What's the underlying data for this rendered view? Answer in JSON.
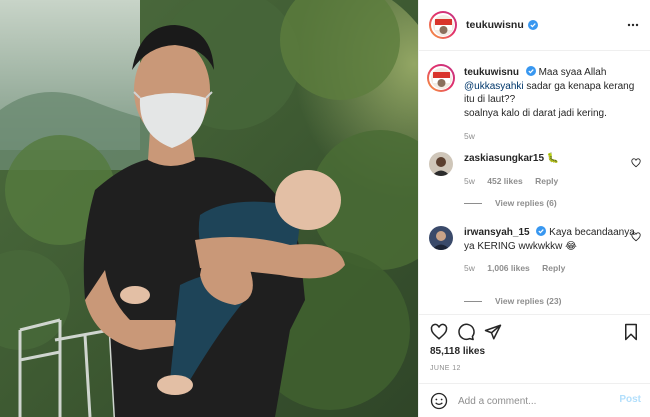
{
  "post": {
    "author": {
      "username": "teukuwisnu",
      "verified": true
    },
    "photo": {
      "subject": "man in face mask holding a sleeping baby outdoors",
      "caption_alt": ""
    },
    "caption": {
      "username": "teukuwisnu",
      "text_before_mention": "Maa syaa Allah",
      "mention": "@ukkasyahki",
      "text_after_mention": "sadar ga kenapa kerang itu di laut??",
      "line_two": "soalnya kalo di darat jadi kering.",
      "age": "5w"
    },
    "comments": [
      {
        "username": "zaskiasungkar15",
        "verified": false,
        "text": "🐛",
        "age": "5w",
        "likes": "452 likes",
        "reply_label": "Reply",
        "view_replies": "View replies (6)"
      },
      {
        "username": "irwansyah_15",
        "verified": true,
        "text": "Kaya becandaanya ya KERING wwkwkkw 😂",
        "age": "5w",
        "likes": "1,006 likes",
        "reply_label": "Reply",
        "view_replies": "View replies (23)"
      }
    ],
    "like_count": "85,118 likes",
    "date": "JUNE 12",
    "composer": {
      "placeholder": "Add a comment...",
      "post_label": "Post"
    },
    "icons": {
      "more": "more-horizontal-icon",
      "like": "heart-icon",
      "comment": "comment-bubble-icon",
      "share": "paper-plane-icon",
      "save": "bookmark-icon",
      "emoji": "smiley-icon",
      "verified": "verified-badge-icon"
    },
    "colors": {
      "verified_blue": "#3897f0",
      "link_blue": "#00376b",
      "muted": "#8e8e8e",
      "post_disabled": "#b2dffc",
      "text": "#262626"
    }
  }
}
